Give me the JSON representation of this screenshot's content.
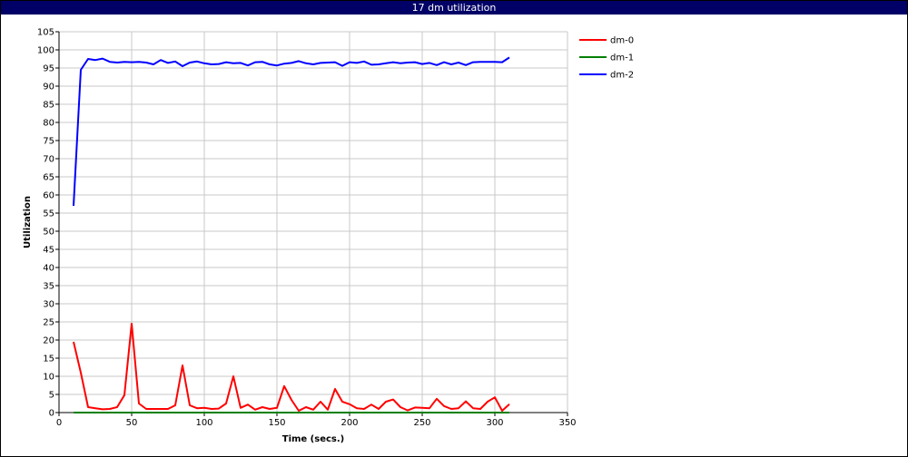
{
  "window": {
    "title": "17 dm utilization"
  },
  "chart_data": {
    "type": "line",
    "title": "17 dm utilization",
    "xlabel": "Time (secs.)",
    "ylabel": "Utilization",
    "xlim": [
      0,
      350
    ],
    "ylim": [
      0,
      105
    ],
    "xticks": [
      0,
      50,
      100,
      150,
      200,
      250,
      300,
      350
    ],
    "yticks": [
      0,
      5,
      10,
      15,
      20,
      25,
      30,
      35,
      40,
      45,
      50,
      55,
      60,
      65,
      70,
      75,
      80,
      85,
      90,
      95,
      100,
      105
    ],
    "grid": true,
    "legend": "top-right",
    "x": [
      10,
      15,
      20,
      25,
      30,
      35,
      40,
      45,
      50,
      55,
      60,
      65,
      70,
      75,
      80,
      85,
      90,
      95,
      100,
      105,
      110,
      115,
      120,
      125,
      130,
      135,
      140,
      145,
      150,
      155,
      160,
      165,
      170,
      175,
      180,
      185,
      190,
      195,
      200,
      205,
      210,
      215,
      220,
      225,
      230,
      235,
      240,
      245,
      250,
      255,
      260,
      265,
      270,
      275,
      280,
      285,
      290,
      295,
      300,
      305,
      310
    ],
    "series": [
      {
        "name": "dm-0",
        "color": "#ff0000",
        "values": [
          19.5,
          11,
          1.5,
          1.2,
          0.9,
          1,
          1.5,
          4.8,
          24.5,
          2.5,
          1,
          1,
          1,
          1,
          2,
          13,
          2,
          1.2,
          1.3,
          1,
          1.1,
          2.5,
          10,
          1.3,
          2.2,
          0.8,
          1.5,
          1,
          1.3,
          7.3,
          3.5,
          0.5,
          1.5,
          0.8,
          3,
          0.8,
          6.5,
          3,
          2.3,
          1.2,
          1,
          2.2,
          1,
          3,
          3.6,
          1.5,
          0.6,
          1.4,
          1.3,
          1.2,
          3.8,
          1.8,
          1,
          1.2,
          3.1,
          1.2,
          1,
          3,
          4.2,
          0.5,
          2.3
        ]
      },
      {
        "name": "dm-1",
        "color": "#008000",
        "values": [
          0,
          0,
          0,
          0,
          0,
          0,
          0,
          0,
          0,
          0,
          0,
          0,
          0,
          0,
          0,
          0,
          0,
          0,
          0,
          0,
          0,
          0,
          0,
          0,
          0,
          0,
          0,
          0,
          0,
          0,
          0,
          0,
          0,
          0,
          0,
          0,
          0,
          0,
          0,
          0,
          0,
          0,
          0,
          0,
          0,
          0,
          0,
          0,
          0,
          0,
          0,
          0,
          0,
          0,
          0,
          0,
          0,
          0,
          0,
          0,
          0
        ]
      },
      {
        "name": "dm-2",
        "color": "#0000ff",
        "values": [
          57,
          94.5,
          97.5,
          97.2,
          97.6,
          96.7,
          96.5,
          96.7,
          96.6,
          96.7,
          96.5,
          96,
          97.2,
          96.4,
          96.8,
          95.5,
          96.5,
          96.8,
          96.3,
          96,
          96.1,
          96.6,
          96.3,
          96.4,
          95.7,
          96.6,
          96.7,
          96,
          95.7,
          96.2,
          96.4,
          96.9,
          96.3,
          96,
          96.4,
          96.5,
          96.6,
          95.6,
          96.6,
          96.4,
          96.8,
          95.9,
          96,
          96.3,
          96.6,
          96.3,
          96.5,
          96.6,
          96.1,
          96.4,
          95.8,
          96.6,
          96,
          96.5,
          95.8,
          96.6,
          96.7,
          96.7,
          96.7,
          96.6,
          97.9
        ]
      }
    ]
  }
}
